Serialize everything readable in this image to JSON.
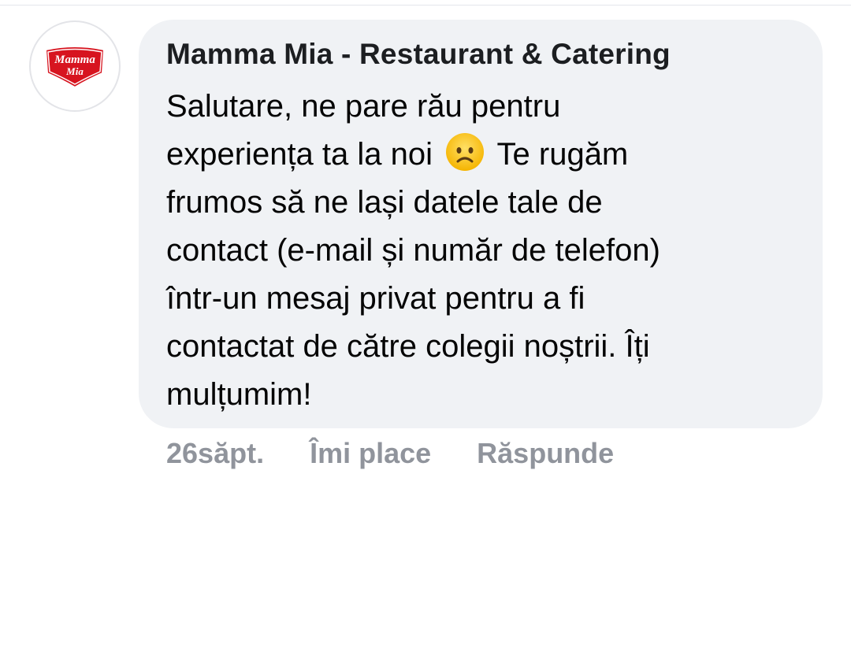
{
  "comment": {
    "avatar_logo_text": [
      "Mamma",
      "Mia"
    ],
    "author": "Mamma Mia - Restaurant & Catering",
    "lines": [
      "Salutare, ne pare rău pentru",
      "experiența ta la noi",
      "Te rugăm",
      "frumos să ne lași datele tale de",
      "contact (e-mail și număr de telefon)",
      "într-un mesaj privat pentru a fi",
      "contactat de către colegii noștrii. Îți",
      "mulțumim!"
    ],
    "emoji": "frowning-face-icon",
    "time": "26săpt.",
    "like_label": "Îmi place",
    "reply_label": "Răspunde"
  },
  "colors": {
    "bubble": "#f0f2f5",
    "logo_red": "#d7141f",
    "action_text": "#90949c"
  }
}
